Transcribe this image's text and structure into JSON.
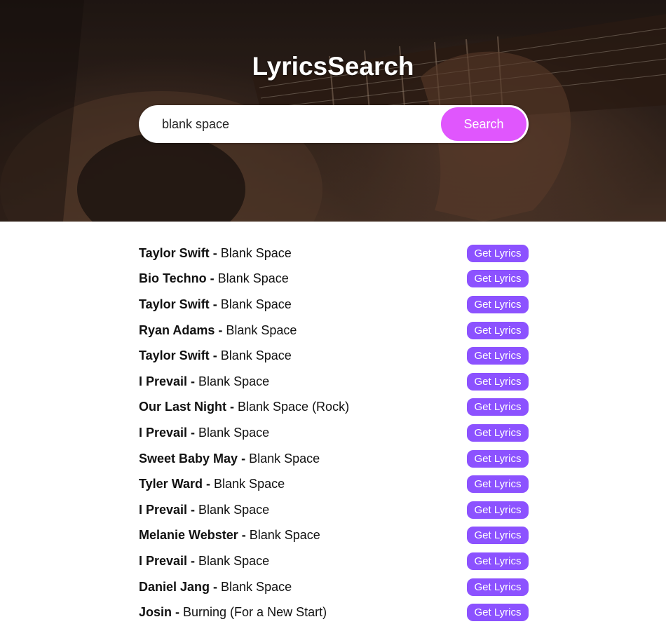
{
  "header": {
    "title": "LyricsSearch"
  },
  "search": {
    "value": "blank space",
    "button_label": "Search"
  },
  "results": [
    {
      "artist": "Taylor Swift",
      "separator": " - ",
      "title": "Blank Space",
      "button_label": "Get Lyrics"
    },
    {
      "artist": "Bio Techno",
      "separator": " - ",
      "title": "Blank Space",
      "button_label": "Get Lyrics"
    },
    {
      "artist": "Taylor Swift",
      "separator": " - ",
      "title": "Blank Space",
      "button_label": "Get Lyrics"
    },
    {
      "artist": "Ryan Adams",
      "separator": " - ",
      "title": "Blank Space",
      "button_label": "Get Lyrics"
    },
    {
      "artist": "Taylor Swift",
      "separator": " - ",
      "title": "Blank Space",
      "button_label": "Get Lyrics"
    },
    {
      "artist": "I Prevail",
      "separator": " - ",
      "title": "Blank Space",
      "button_label": "Get Lyrics"
    },
    {
      "artist": "Our Last Night",
      "separator": " - ",
      "title": "Blank Space (Rock)",
      "button_label": "Get Lyrics"
    },
    {
      "artist": "I Prevail",
      "separator": " - ",
      "title": "Blank Space",
      "button_label": "Get Lyrics"
    },
    {
      "artist": "Sweet Baby May",
      "separator": " - ",
      "title": "Blank Space",
      "button_label": "Get Lyrics"
    },
    {
      "artist": "Tyler Ward",
      "separator": " - ",
      "title": "Blank Space",
      "button_label": "Get Lyrics"
    },
    {
      "artist": "I Prevail",
      "separator": " - ",
      "title": "Blank Space",
      "button_label": "Get Lyrics"
    },
    {
      "artist": "Melanie Webster",
      "separator": " - ",
      "title": "Blank Space",
      "button_label": "Get Lyrics"
    },
    {
      "artist": "I Prevail",
      "separator": " - ",
      "title": "Blank Space",
      "button_label": "Get Lyrics"
    },
    {
      "artist": "Daniel Jang",
      "separator": " - ",
      "title": "Blank Space",
      "button_label": "Get Lyrics"
    },
    {
      "artist": "Josin",
      "separator": " - ",
      "title": "Burning (For a New Start)",
      "button_label": "Get Lyrics"
    }
  ],
  "colors": {
    "search_button": "#e056fd",
    "lyrics_button": "#8c52ff",
    "hero_tint": "#3b2a22"
  }
}
